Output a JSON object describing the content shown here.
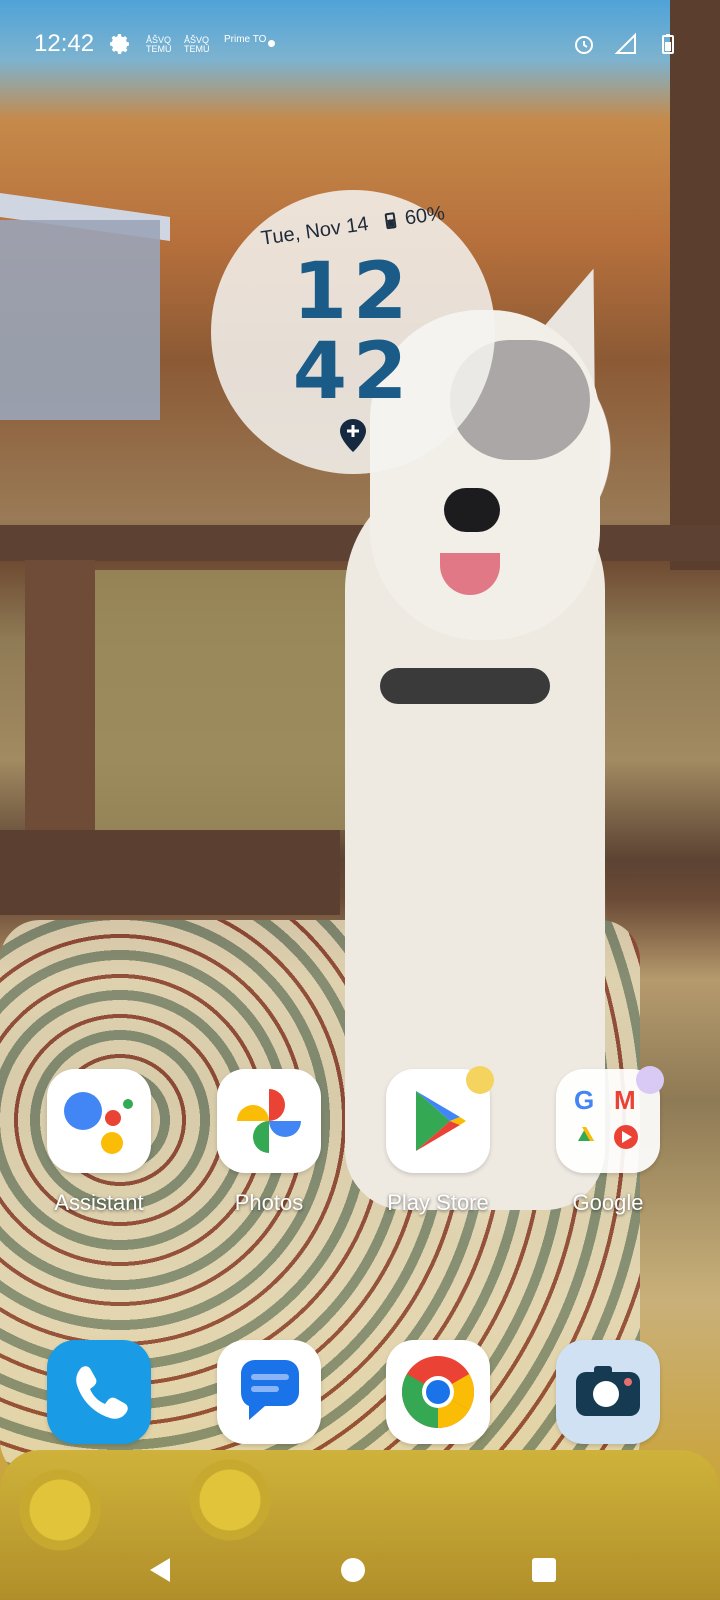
{
  "status_bar": {
    "time": "12:42",
    "temu_1": "ÅŠVQ TEMU",
    "temu_2": "ÅŠVQ TEMU",
    "prime": "Prime TO"
  },
  "clock_widget": {
    "date": "Tue, Nov 14",
    "battery": "60%",
    "hour": "12",
    "minute": "42"
  },
  "apps": [
    {
      "label": "Assistant"
    },
    {
      "label": "Photos"
    },
    {
      "label": "Play Store"
    },
    {
      "label": "Google"
    }
  ],
  "dock": [
    {
      "name": "Phone"
    },
    {
      "name": "Messages"
    },
    {
      "name": "Chrome"
    },
    {
      "name": "Camera"
    }
  ],
  "colors": {
    "clock_digits": "#1a5b87",
    "play_badge": "#f4d35e",
    "google_badge": "#d9c9f5"
  }
}
